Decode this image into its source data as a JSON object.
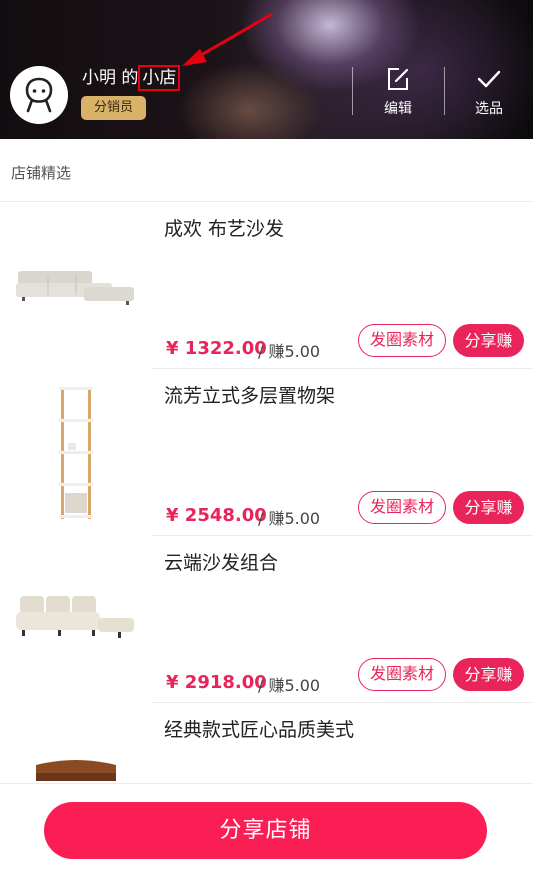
{
  "header": {
    "owner_name": "小明 的",
    "shop_suffix": "小店",
    "role_badge": "分销员",
    "edit_label": "编辑",
    "select_label": "选品"
  },
  "section": {
    "title": "店铺精选"
  },
  "products": [
    {
      "title": "成欢 布艺沙发",
      "price": "¥ 1322.00",
      "earn": "/ 赚5.00",
      "material_label": "发圈素材",
      "share_label": "分享赚"
    },
    {
      "title": "流芳立式多层置物架",
      "price": "¥ 2548.00",
      "earn": "/ 赚5.00",
      "material_label": "发圈素材",
      "share_label": "分享赚"
    },
    {
      "title": "云端沙发组合",
      "price": "¥ 2918.00",
      "earn": "/ 赚5.00",
      "material_label": "发圈素材",
      "share_label": "分享赚"
    },
    {
      "title": "经典款式匠心品质美式"
    }
  ],
  "bottom": {
    "share_shop_label": "分享店铺"
  },
  "colors": {
    "accent": "#e8245a",
    "badge": "#d9b26a",
    "annotation": "#e60012"
  }
}
